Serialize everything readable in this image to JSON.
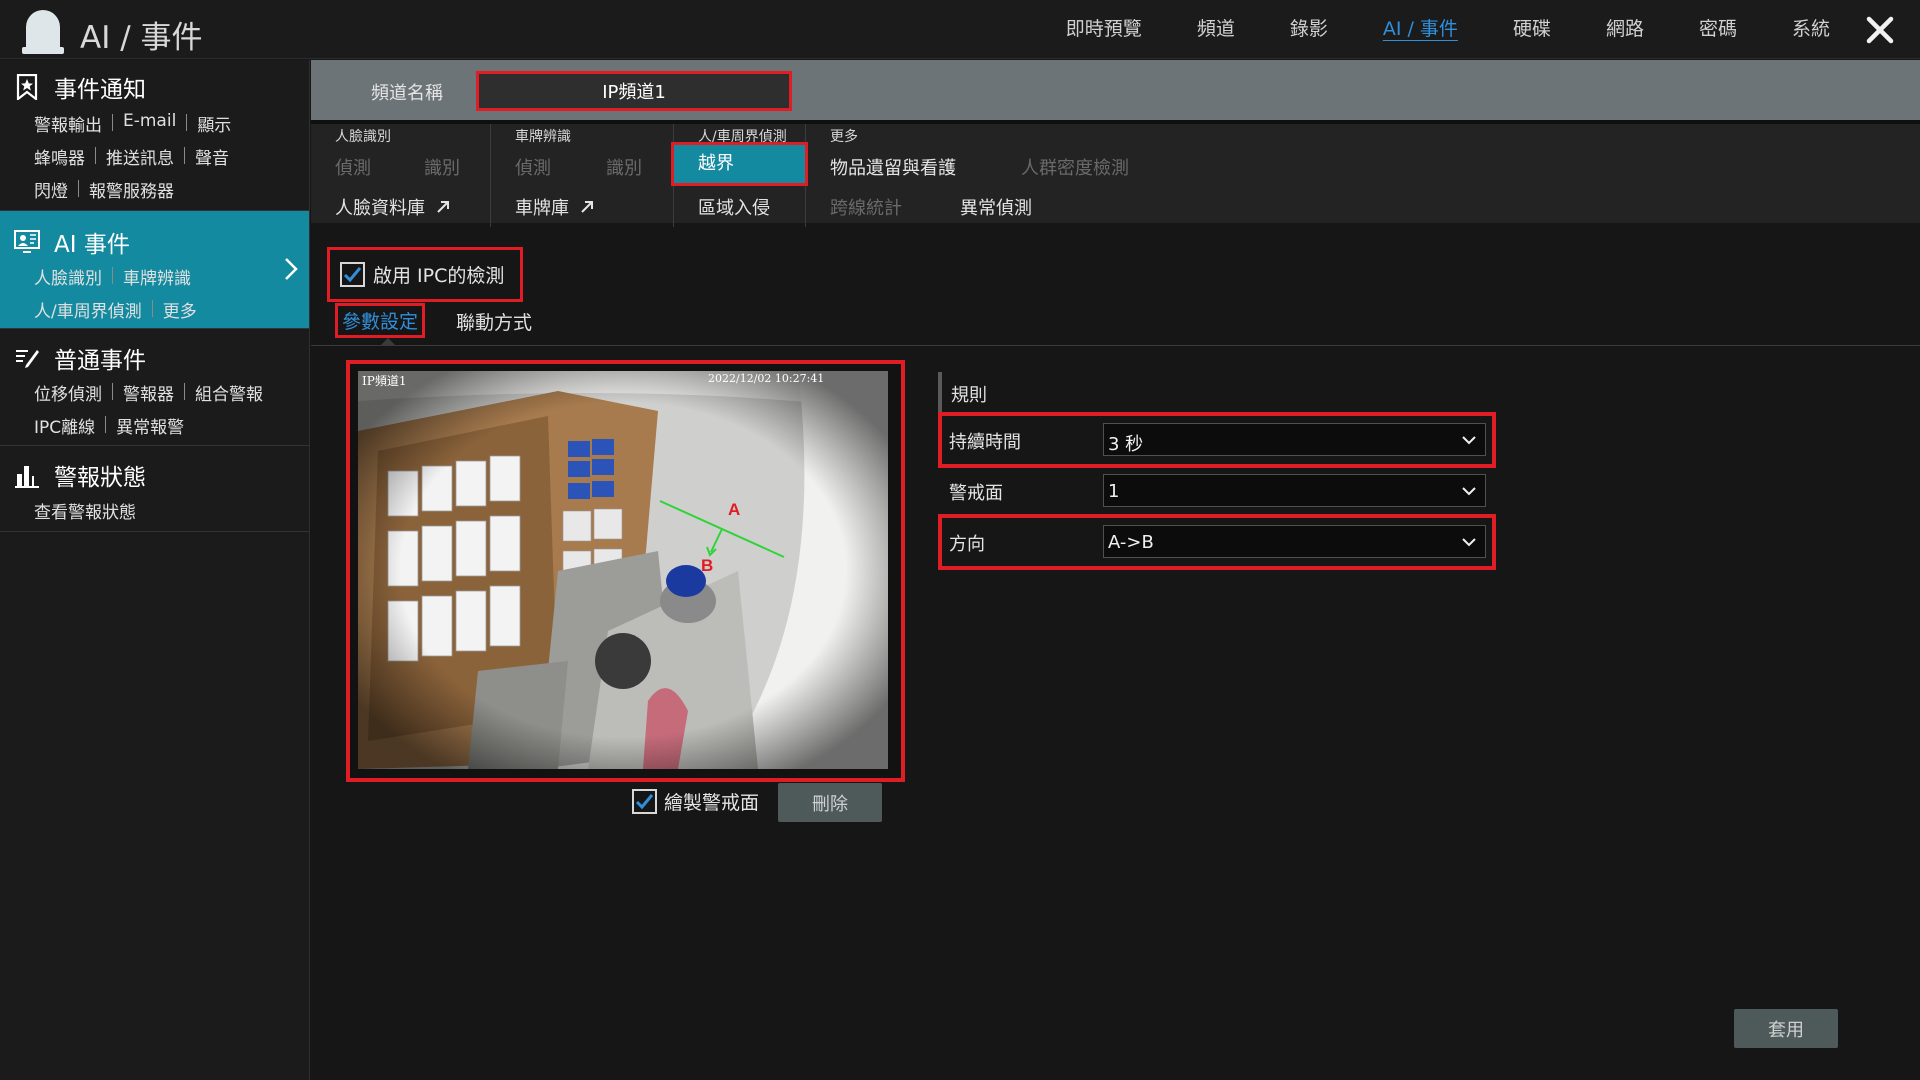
{
  "app": {
    "title": "AI / 事件"
  },
  "topnav": [
    {
      "label": "即時預覽",
      "active": false
    },
    {
      "label": "頻道",
      "active": false
    },
    {
      "label": "錄影",
      "active": false
    },
    {
      "label": "AI / 事件",
      "active": true
    },
    {
      "label": "硬碟",
      "active": false
    },
    {
      "label": "網路",
      "active": false
    },
    {
      "label": "密碼",
      "active": false
    },
    {
      "label": "系統",
      "active": false
    }
  ],
  "sidebar": {
    "event_notify": {
      "title": "事件通知",
      "links": [
        "警報輸出",
        "E-mail",
        "顯示",
        "蜂鳴器",
        "推送訊息",
        "聲音",
        "閃燈",
        "報警服務器"
      ]
    },
    "ai_event": {
      "title": "AI 事件",
      "links": [
        "人臉識別",
        "車牌辨識",
        "人/車周界偵測",
        "更多"
      ]
    },
    "normal_event": {
      "title": "普通事件",
      "links": [
        "位移偵測",
        "警報器",
        "組合警報",
        "IPC離線",
        "異常報警"
      ]
    },
    "alarm_status": {
      "title": "警報狀態",
      "links": [
        "查看警報狀態"
      ]
    }
  },
  "channel": {
    "label": "頻道名稱",
    "value": "IP頻道1"
  },
  "functions": {
    "face": {
      "label": "人臉識別",
      "detect": "偵測",
      "recognize": "識別",
      "database": "人臉資料庫"
    },
    "plate": {
      "label": "車牌辨識",
      "detect": "偵測",
      "recognize": "識別",
      "database": "車牌庫"
    },
    "perimeter": {
      "label": "人/車周界偵測",
      "crossline": "越界",
      "intrusion": "區域入侵"
    },
    "more": {
      "label": "更多",
      "object_left": "物品遺留與看護",
      "crowd": "人群密度檢測",
      "cross_count": "跨線統計",
      "anomaly": "異常偵測"
    }
  },
  "enable_ipc": {
    "label": "啟用 IPC的檢測",
    "checked": true
  },
  "subtabs": {
    "params": "參數設定",
    "linkage": "聯動方式"
  },
  "video": {
    "osd_channel": "IP頻道1",
    "osd_time": "2022/12/02 10:27:41",
    "line_label_a": "A",
    "line_label_b": "B"
  },
  "draw_zone": {
    "label": "繪製警戒面",
    "checked": true
  },
  "buttons": {
    "delete": "刪除",
    "apply": "套用"
  },
  "rules": {
    "heading": "規則",
    "duration": {
      "label": "持續時間",
      "value": "3 秒"
    },
    "zone": {
      "label": "警戒面",
      "value": "1"
    },
    "direction": {
      "label": "方向",
      "value": "A->B"
    }
  },
  "colors": {
    "accent": "#138aa0",
    "highlight": "#e01c24",
    "active_link": "#2f8fdb"
  }
}
